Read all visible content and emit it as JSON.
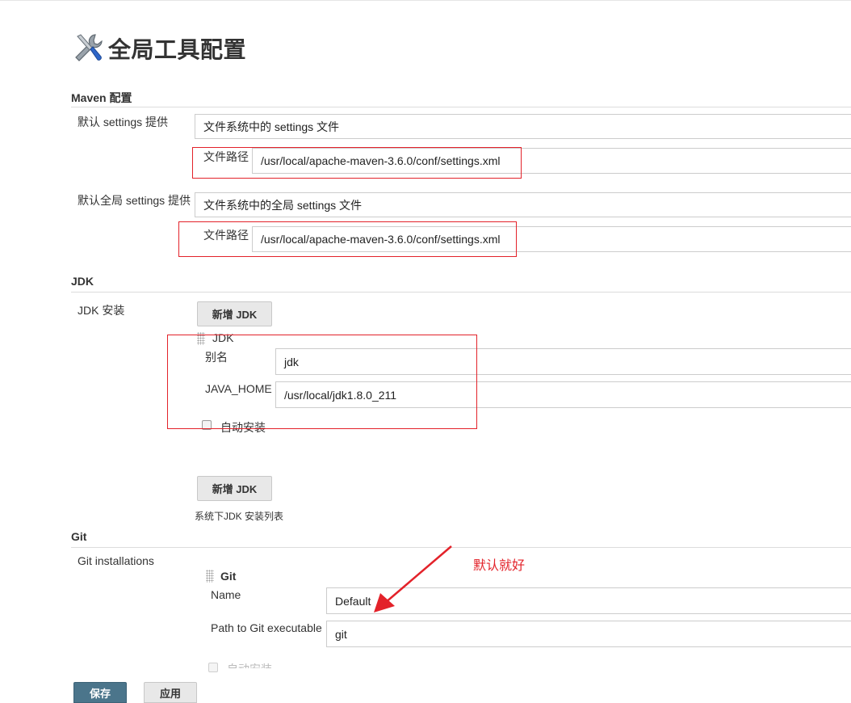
{
  "page_title": "全局工具配置",
  "maven": {
    "section_title": "Maven 配置",
    "default_settings_label": "默认 settings 提供",
    "default_settings_value": "文件系统中的 settings 文件",
    "file_path_label": "文件路径",
    "file_path_value": "/usr/local/apache-maven-3.6.0/conf/settings.xml",
    "global_settings_label": "默认全局 settings 提供",
    "global_settings_value": "文件系统中的全局 settings 文件",
    "global_file_path_label": "文件路径",
    "global_file_path_value": "/usr/local/apache-maven-3.6.0/conf/settings.xml"
  },
  "jdk": {
    "section_title": "JDK",
    "install_label": "JDK 安装",
    "add_button": "新增 JDK",
    "item_title": "JDK",
    "alias_label": "别名",
    "alias_value": "jdk",
    "java_home_label": "JAVA_HOME",
    "java_home_value": "/usr/local/jdk1.8.0_211",
    "auto_install_label": "自动安装",
    "add_button_2": "新增 JDK",
    "list_hint": "系统下JDK 安装列表"
  },
  "git": {
    "section_title": "Git",
    "installations_label": "Git installations",
    "item_title": "Git",
    "name_label": "Name",
    "name_value": "Default",
    "path_label": "Path to Git executable",
    "path_value": "git",
    "auto_install_label": "自动安装",
    "annotation": "默认就好"
  },
  "footer": {
    "save_button": "保存",
    "apply_button": "应用"
  },
  "colors": {
    "annotation_red": "#e3222a",
    "primary_button": "#4b758b"
  }
}
